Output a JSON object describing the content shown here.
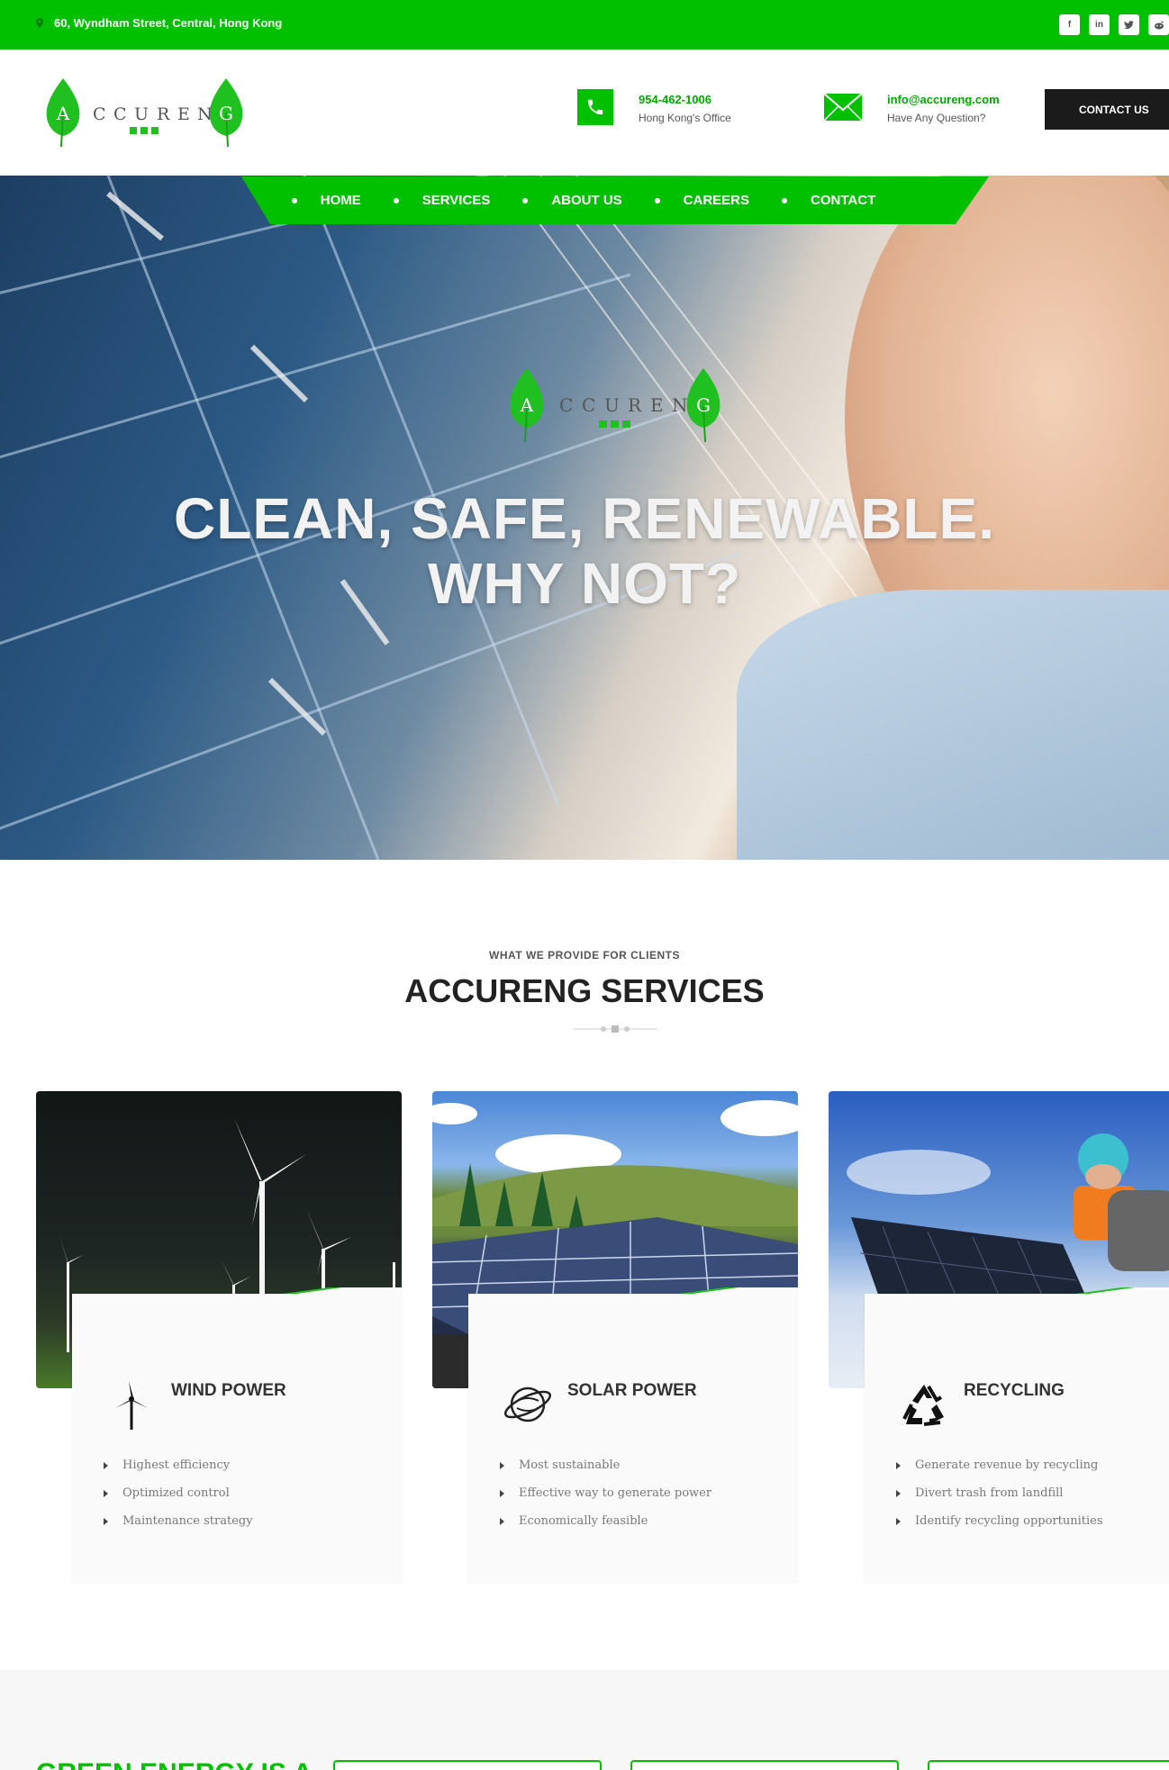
{
  "topbar": {
    "address": "60, Wyndham Street, Central, Hong Kong",
    "socials": [
      "facebook-icon",
      "linkedin-icon",
      "twitter-icon",
      "reddit-icon"
    ]
  },
  "header": {
    "logo_text": "ACCURENG",
    "logo_letters": [
      "A",
      "C",
      "C",
      "U",
      "R",
      "E",
      "N",
      "G"
    ],
    "phone": {
      "value": "954-462-1006",
      "caption": "Hong Kong's Office"
    },
    "email": {
      "value": "info@accureng.com",
      "caption": "Have Any Question?"
    },
    "contact_button": "CONTACT US"
  },
  "nav": {
    "items": [
      "HOME",
      "SERVICES",
      "ABOUT US",
      "CAREERS",
      "CONTACT"
    ]
  },
  "hero": {
    "title_line1": "CLEAN, SAFE, RENEWABLE.",
    "title_line2": "WHY NOT?"
  },
  "services": {
    "subtitle": "WHAT WE PROVIDE FOR CLIENTS",
    "title": "ACCURENG SERVICES",
    "cards": [
      {
        "title": "WIND POWER",
        "icon": "wind-turbine-icon",
        "items": [
          "Highest efficiency",
          "Optimized control",
          "Maintenance strategy"
        ]
      },
      {
        "title": "SOLAR POWER",
        "icon": "solar-planet-icon",
        "items": [
          "Most sustainable",
          "Effective way to generate power",
          "Economically feasible"
        ]
      },
      {
        "title": "RECYCLING",
        "icon": "recycle-icon",
        "items": [
          "Generate revenue by recycling",
          "Divert trash from landfill",
          "Identify recycling opportunities"
        ]
      }
    ]
  },
  "bottom": {
    "title_partial": "GREEN ENERGY IS A"
  },
  "colors": {
    "brand_green": "#00c000",
    "dark": "#1b1b1b",
    "text": "#333333"
  }
}
